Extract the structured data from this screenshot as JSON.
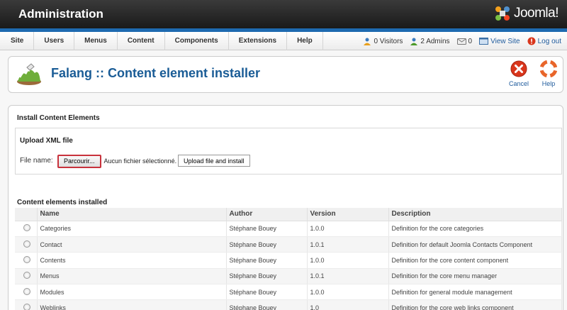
{
  "header": {
    "title": "Administration",
    "logo_text": "Joomla!"
  },
  "menu": {
    "items": [
      {
        "label": "Site"
      },
      {
        "label": "Users"
      },
      {
        "label": "Menus"
      },
      {
        "label": "Content"
      },
      {
        "label": "Components"
      },
      {
        "label": "Extensions"
      },
      {
        "label": "Help"
      }
    ]
  },
  "status": {
    "visitors": "0 Visitors",
    "admins": "2 Admins",
    "messages": "0",
    "view_site": "View Site",
    "logout": "Log out"
  },
  "toolbar": {
    "page_title": "Falang :: Content element installer",
    "cancel_label": "Cancel",
    "help_label": "Help"
  },
  "install": {
    "legend": "Install Content Elements",
    "upload_legend": "Upload XML file",
    "file_label": "File name:",
    "browse_label": "Parcourir...",
    "no_file_text": "Aucun fichier sélectionné.",
    "upload_button": "Upload file and install"
  },
  "installed": {
    "title": "Content elements installed",
    "columns": [
      "",
      "Name",
      "Author",
      "Version",
      "Description"
    ],
    "rows": [
      {
        "name": "Categories",
        "author": "Stéphane Bouey",
        "version": "1.0.0",
        "description": "Definition for the core categories"
      },
      {
        "name": "Contact",
        "author": "Stéphane Bouey",
        "version": "1.0.1",
        "description": "Definition for default Joomla Contacts Component"
      },
      {
        "name": "Contents",
        "author": "Stéphane Bouey",
        "version": "1.0.0",
        "description": "Definition for the core content component"
      },
      {
        "name": "Menus",
        "author": "Stéphane Bouey",
        "version": "1.0.1",
        "description": "Definition for the core menu manager"
      },
      {
        "name": "Modules",
        "author": "Stéphane Bouey",
        "version": "1.0.0",
        "description": "Definition for general module management"
      },
      {
        "name": "Weblinks",
        "author": "Stéphane Bouey",
        "version": "1.0",
        "description": "Definition for the core web links component"
      }
    ]
  },
  "colors": {
    "header_bg": "#1a1a1a",
    "accent_blue": "#1e6ab0",
    "title_blue": "#1a5c96",
    "cancel_red": "#d9361c",
    "help_orange": "#e8652a"
  }
}
